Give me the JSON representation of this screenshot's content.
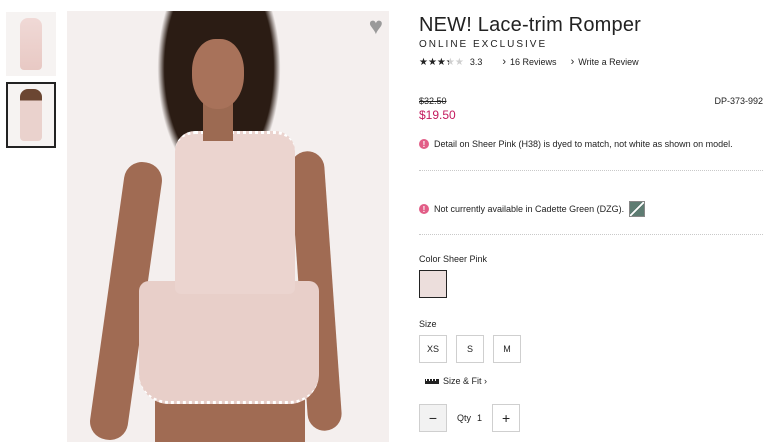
{
  "thumbnails": [
    {
      "alt": "romper-flat"
    },
    {
      "alt": "model-front",
      "active": true
    }
  ],
  "product": {
    "title": "NEW! Lace-trim Romper",
    "subtitle": "ONLINE EXCLUSIVE",
    "rating_value": "3.3",
    "rating_stars": 3.3,
    "reviews_link": "16 Reviews",
    "write_review_link": "Write a Review",
    "original_price": "$32.50",
    "sale_price": "$19.50",
    "sku": "DP-373-992",
    "notice_1": "Detail on Sheer Pink (H38) is dyed to match, not white as shown on model.",
    "notice_2": "Not currently available in Cadette Green (DZG).",
    "color_label": "Color Sheer Pink",
    "size_label": "Size",
    "sizes": [
      "XS",
      "S",
      "M"
    ],
    "size_fit_link": "Size & Fit",
    "qty_label": "Qty",
    "qty_value": "1",
    "qty_minus": "−",
    "qty_plus": "+"
  },
  "colors": {
    "sale_price": "#c3195d",
    "notice_icon": "#e25d87",
    "swatch_sheer_pink": "#ecdedc",
    "swatch_cadette_green": "#5e7c72"
  },
  "icons": {
    "favorite": "heart-icon",
    "notice": "info-icon",
    "size_fit": "ruler-icon"
  }
}
